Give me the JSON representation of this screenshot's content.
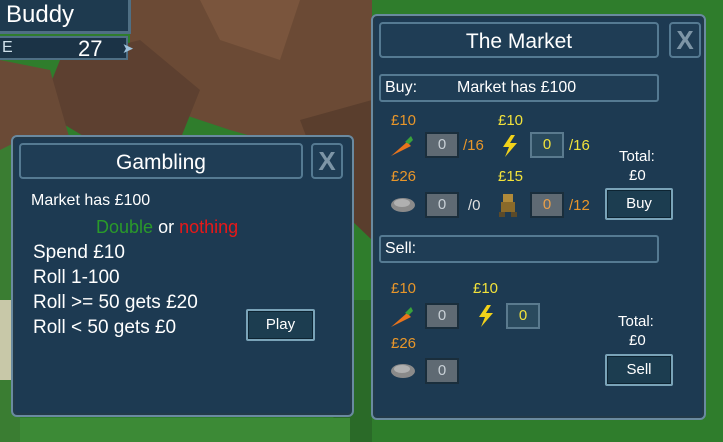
{
  "player": {
    "name": "Buddy",
    "level_label": "E",
    "level_value": "27"
  },
  "gambling": {
    "title": "Gambling",
    "market_text": "Market has £100",
    "double_text": "Double",
    "or_text": "or",
    "nothing_text": "nothing",
    "lines": [
      "Spend £10",
      "Roll 1-100",
      "Roll >= 50 gets £20",
      "Roll < 50 gets £0"
    ],
    "play_label": "Play",
    "close_label": "X"
  },
  "market": {
    "title": "The Market",
    "close_label": "X",
    "buy": {
      "label": "Buy:",
      "market_text": "Market has £100",
      "items": [
        {
          "icon": "carrot-icon",
          "price": "£10",
          "value": "0",
          "stock": "/16"
        },
        {
          "icon": "lightning-icon",
          "price": "£10",
          "value": "0",
          "stock": "/16"
        },
        {
          "icon": "stone-icon",
          "price": "£26",
          "value": "0",
          "stock": "/0"
        },
        {
          "icon": "robot-icon",
          "price": "£15",
          "value": "0",
          "stock": "/12"
        }
      ],
      "total_label": "Total:",
      "total_value": "£0",
      "button_label": "Buy"
    },
    "sell": {
      "label": "Sell:",
      "items": [
        {
          "icon": "carrot-icon",
          "price": "£10",
          "value": "0"
        },
        {
          "icon": "lightning-icon",
          "price": "£10",
          "value": "0"
        },
        {
          "icon": "stone-icon",
          "price": "£26",
          "value": "0"
        }
      ],
      "total_label": "Total:",
      "total_value": "£0",
      "button_label": "Sell"
    }
  },
  "colors": {
    "double": "#2a9a2a",
    "nothing": "#e81818",
    "orange_price": "#e8962a",
    "yellow_price": "#f2e23b"
  }
}
